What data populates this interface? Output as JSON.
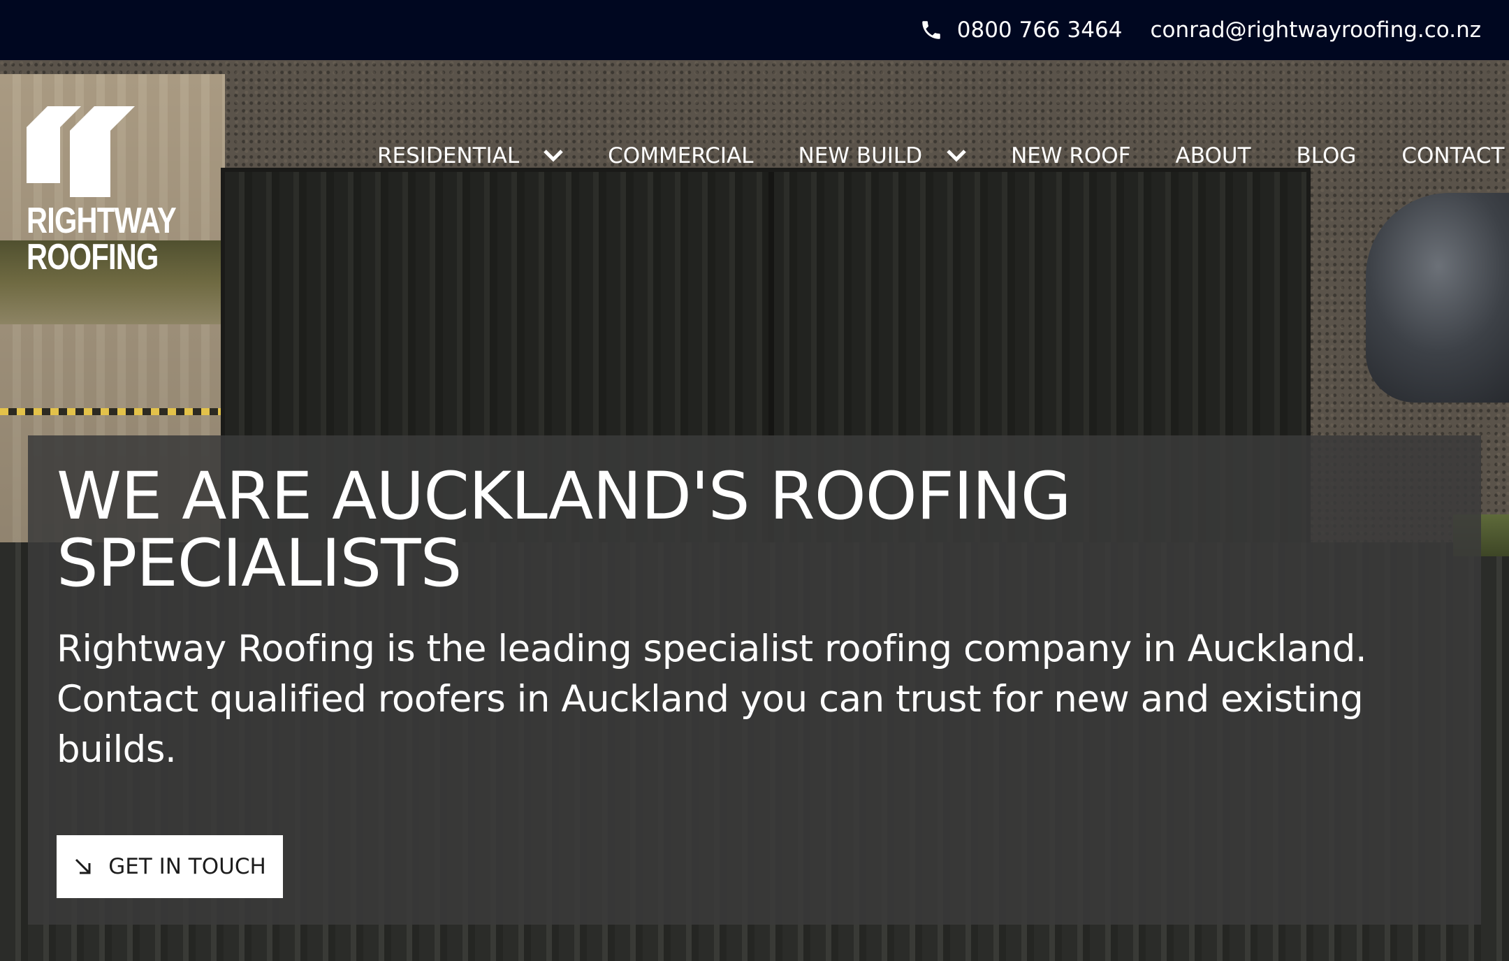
{
  "topbar": {
    "phone": "0800 766 3464",
    "email": "conrad@rightwayroofing.co.nz",
    "phone_icon": "phone-icon",
    "background": "#000720"
  },
  "logo": {
    "line1": "RIGHTWAY",
    "line2": "ROOFING"
  },
  "nav": {
    "items": [
      {
        "label": "RESIDENTIAL",
        "has_dropdown": true
      },
      {
        "label": "COMMERCIAL",
        "has_dropdown": false
      },
      {
        "label": "NEW BUILD",
        "has_dropdown": true
      },
      {
        "label": "NEW ROOF",
        "has_dropdown": false
      },
      {
        "label": "ABOUT",
        "has_dropdown": false
      },
      {
        "label": "BLOG",
        "has_dropdown": false
      },
      {
        "label": "CONTACT",
        "has_dropdown": false
      }
    ]
  },
  "hero": {
    "heading": "WE ARE AUCKLAND'S ROOFING SPECIALISTS",
    "body": "Rightway Roofing is the leading specialist roofing company in Auckland. Contact qualified roofers in Auckland you can trust for new and existing builds.",
    "cta_label": "GET IN TOUCH",
    "cta_icon": "arrow-down-right-icon"
  }
}
